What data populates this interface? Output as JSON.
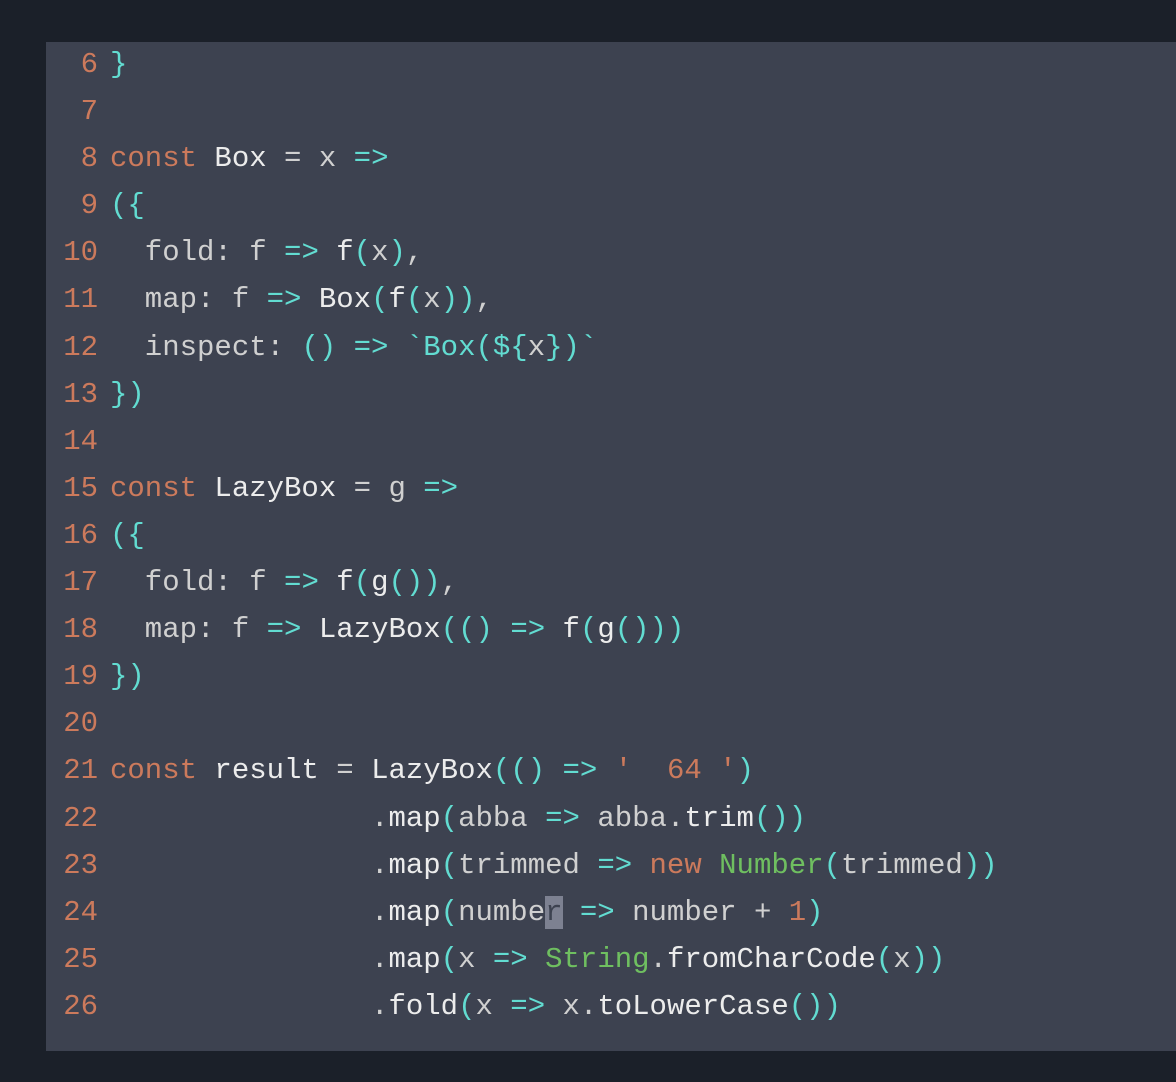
{
  "editor": {
    "startLine": 6,
    "lines": [
      {
        "num": 6,
        "tokens": [
          {
            "t": "}",
            "c": "tok-paren"
          }
        ]
      },
      {
        "num": 7,
        "tokens": []
      },
      {
        "num": 8,
        "tokens": [
          {
            "t": "const ",
            "c": "tok-keyword"
          },
          {
            "t": "Box ",
            "c": "tok-fn"
          },
          {
            "t": "= ",
            "c": "tok-plain"
          },
          {
            "t": "x ",
            "c": "tok-plain"
          },
          {
            "t": "=>",
            "c": "tok-arrow"
          }
        ]
      },
      {
        "num": 9,
        "tokens": [
          {
            "t": "({",
            "c": "tok-paren"
          }
        ]
      },
      {
        "num": 10,
        "tokens": [
          {
            "t": "  fold: ",
            "c": "tok-plain"
          },
          {
            "t": "f ",
            "c": "tok-plain"
          },
          {
            "t": "=> ",
            "c": "tok-arrow"
          },
          {
            "t": "f",
            "c": "tok-fn"
          },
          {
            "t": "(",
            "c": "tok-paren"
          },
          {
            "t": "x",
            "c": "tok-plain"
          },
          {
            "t": ")",
            "c": "tok-paren"
          },
          {
            "t": ",",
            "c": "tok-plain"
          }
        ]
      },
      {
        "num": 11,
        "tokens": [
          {
            "t": "  map: ",
            "c": "tok-plain"
          },
          {
            "t": "f ",
            "c": "tok-plain"
          },
          {
            "t": "=> ",
            "c": "tok-arrow"
          },
          {
            "t": "Box",
            "c": "tok-fn"
          },
          {
            "t": "(",
            "c": "tok-paren"
          },
          {
            "t": "f",
            "c": "tok-fn"
          },
          {
            "t": "(",
            "c": "tok-paren"
          },
          {
            "t": "x",
            "c": "tok-plain"
          },
          {
            "t": "))",
            "c": "tok-paren"
          },
          {
            "t": ",",
            "c": "tok-plain"
          }
        ]
      },
      {
        "num": 12,
        "tokens": [
          {
            "t": "  inspect: ",
            "c": "tok-plain"
          },
          {
            "t": "() ",
            "c": "tok-paren"
          },
          {
            "t": "=> ",
            "c": "tok-arrow"
          },
          {
            "t": "`Box(",
            "c": "tok-templ"
          },
          {
            "t": "${",
            "c": "tok-paren"
          },
          {
            "t": "x",
            "c": "tok-plain"
          },
          {
            "t": "}",
            "c": "tok-paren"
          },
          {
            "t": ")`",
            "c": "tok-templ"
          }
        ]
      },
      {
        "num": 13,
        "tokens": [
          {
            "t": "})",
            "c": "tok-paren"
          }
        ]
      },
      {
        "num": 14,
        "tokens": []
      },
      {
        "num": 15,
        "tokens": [
          {
            "t": "const ",
            "c": "tok-keyword"
          },
          {
            "t": "LazyBox ",
            "c": "tok-fn"
          },
          {
            "t": "= ",
            "c": "tok-plain"
          },
          {
            "t": "g ",
            "c": "tok-plain"
          },
          {
            "t": "=>",
            "c": "tok-arrow"
          }
        ]
      },
      {
        "num": 16,
        "tokens": [
          {
            "t": "({",
            "c": "tok-paren"
          }
        ]
      },
      {
        "num": 17,
        "tokens": [
          {
            "t": "  fold: ",
            "c": "tok-plain"
          },
          {
            "t": "f ",
            "c": "tok-plain"
          },
          {
            "t": "=> ",
            "c": "tok-arrow"
          },
          {
            "t": "f",
            "c": "tok-fn"
          },
          {
            "t": "(",
            "c": "tok-paren"
          },
          {
            "t": "g",
            "c": "tok-fn"
          },
          {
            "t": "())",
            "c": "tok-paren"
          },
          {
            "t": ",",
            "c": "tok-plain"
          }
        ]
      },
      {
        "num": 18,
        "tokens": [
          {
            "t": "  map: ",
            "c": "tok-plain"
          },
          {
            "t": "f ",
            "c": "tok-plain"
          },
          {
            "t": "=> ",
            "c": "tok-arrow"
          },
          {
            "t": "LazyBox",
            "c": "tok-fn"
          },
          {
            "t": "(() ",
            "c": "tok-paren"
          },
          {
            "t": "=> ",
            "c": "tok-arrow"
          },
          {
            "t": "f",
            "c": "tok-fn"
          },
          {
            "t": "(",
            "c": "tok-paren"
          },
          {
            "t": "g",
            "c": "tok-fn"
          },
          {
            "t": "()))",
            "c": "tok-paren"
          }
        ]
      },
      {
        "num": 19,
        "tokens": [
          {
            "t": "})",
            "c": "tok-paren"
          }
        ]
      },
      {
        "num": 20,
        "tokens": []
      },
      {
        "num": 21,
        "tokens": [
          {
            "t": "const ",
            "c": "tok-keyword"
          },
          {
            "t": "result ",
            "c": "tok-fn"
          },
          {
            "t": "= ",
            "c": "tok-plain"
          },
          {
            "t": "LazyBox",
            "c": "tok-fn"
          },
          {
            "t": "(() ",
            "c": "tok-paren"
          },
          {
            "t": "=> ",
            "c": "tok-arrow"
          },
          {
            "t": "'  64 '",
            "c": "tok-string"
          },
          {
            "t": ")",
            "c": "tok-paren"
          }
        ]
      },
      {
        "num": 22,
        "tokens": [
          {
            "t": "               .",
            "c": "tok-plain"
          },
          {
            "t": "map",
            "c": "tok-fn"
          },
          {
            "t": "(",
            "c": "tok-paren"
          },
          {
            "t": "abba ",
            "c": "tok-plain"
          },
          {
            "t": "=> ",
            "c": "tok-arrow"
          },
          {
            "t": "abba.",
            "c": "tok-plain"
          },
          {
            "t": "trim",
            "c": "tok-fn"
          },
          {
            "t": "())",
            "c": "tok-paren"
          }
        ]
      },
      {
        "num": 23,
        "tokens": [
          {
            "t": "               .",
            "c": "tok-plain"
          },
          {
            "t": "map",
            "c": "tok-fn"
          },
          {
            "t": "(",
            "c": "tok-paren"
          },
          {
            "t": "trimmed ",
            "c": "tok-plain"
          },
          {
            "t": "=> ",
            "c": "tok-arrow"
          },
          {
            "t": "new ",
            "c": "tok-new"
          },
          {
            "t": "Number",
            "c": "tok-class"
          },
          {
            "t": "(",
            "c": "tok-paren"
          },
          {
            "t": "trimmed",
            "c": "tok-plain"
          },
          {
            "t": "))",
            "c": "tok-paren"
          }
        ]
      },
      {
        "num": 24,
        "tokens": [
          {
            "t": "               .",
            "c": "tok-plain"
          },
          {
            "t": "map",
            "c": "tok-fn"
          },
          {
            "t": "(",
            "c": "tok-paren"
          },
          {
            "t": "numbe",
            "c": "tok-plain"
          },
          {
            "t": "r",
            "c": "cursor-block"
          },
          {
            "t": " ",
            "c": "tok-plain"
          },
          {
            "t": "=> ",
            "c": "tok-arrow"
          },
          {
            "t": "number + ",
            "c": "tok-plain"
          },
          {
            "t": "1",
            "c": "tok-num"
          },
          {
            "t": ")",
            "c": "tok-paren"
          }
        ]
      },
      {
        "num": 25,
        "tokens": [
          {
            "t": "               .",
            "c": "tok-plain"
          },
          {
            "t": "map",
            "c": "tok-fn"
          },
          {
            "t": "(",
            "c": "tok-paren"
          },
          {
            "t": "x ",
            "c": "tok-plain"
          },
          {
            "t": "=> ",
            "c": "tok-arrow"
          },
          {
            "t": "String",
            "c": "tok-class"
          },
          {
            "t": ".",
            "c": "tok-plain"
          },
          {
            "t": "fromCharCode",
            "c": "tok-fn"
          },
          {
            "t": "(",
            "c": "tok-paren"
          },
          {
            "t": "x",
            "c": "tok-plain"
          },
          {
            "t": "))",
            "c": "tok-paren"
          }
        ]
      },
      {
        "num": 26,
        "tokens": [
          {
            "t": "               .",
            "c": "tok-plain"
          },
          {
            "t": "fold",
            "c": "tok-fn"
          },
          {
            "t": "(",
            "c": "tok-paren"
          },
          {
            "t": "x ",
            "c": "tok-plain"
          },
          {
            "t": "=> ",
            "c": "tok-arrow"
          },
          {
            "t": "x.",
            "c": "tok-plain"
          },
          {
            "t": "toLowerCase",
            "c": "tok-fn"
          },
          {
            "t": "())",
            "c": "tok-paren"
          }
        ]
      }
    ]
  }
}
